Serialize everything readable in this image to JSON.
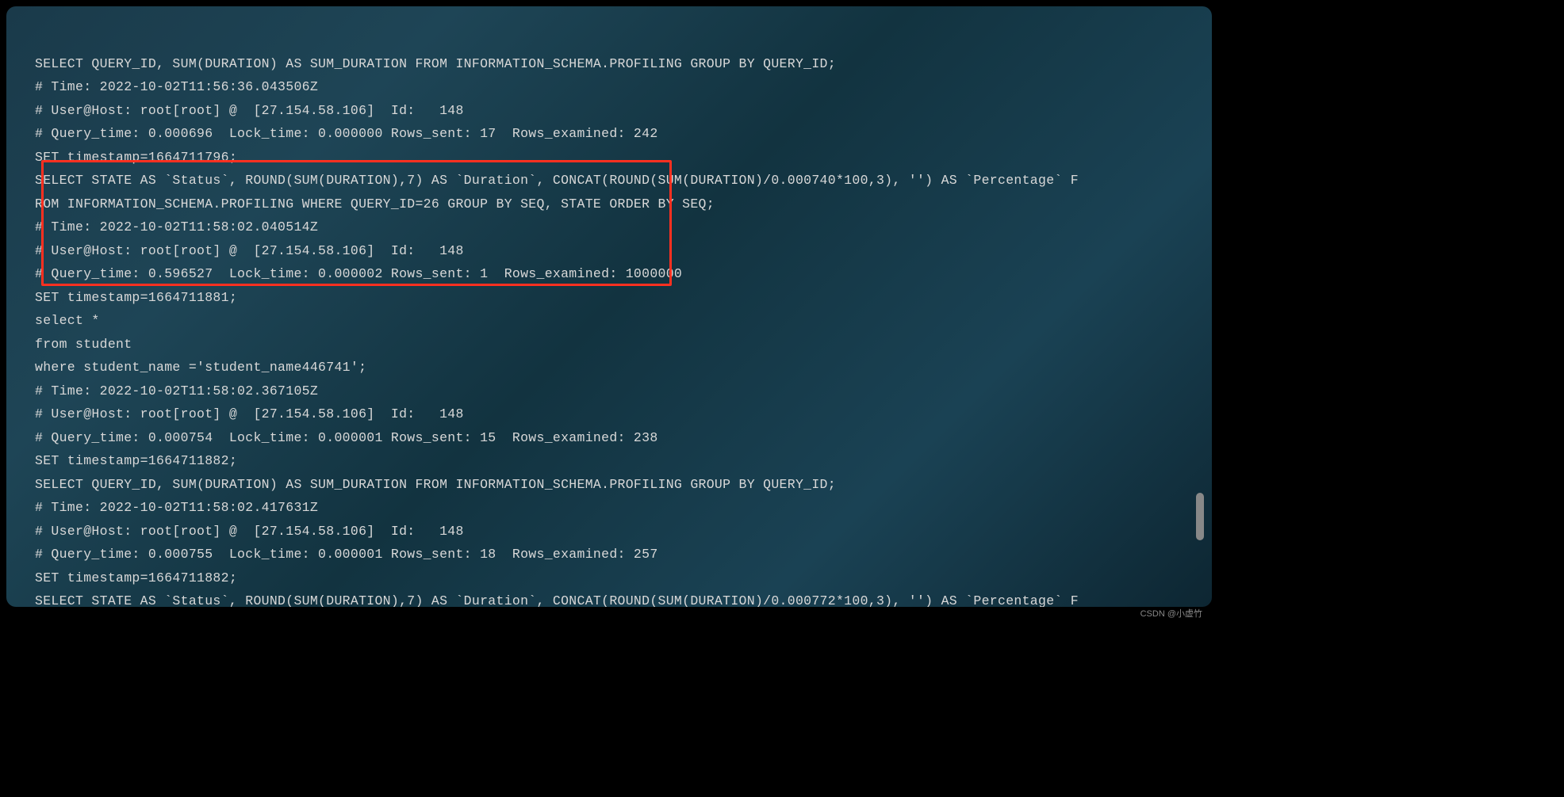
{
  "lines": {
    "l0": "SELECT QUERY_ID, SUM(DURATION) AS SUM_DURATION FROM INFORMATION_SCHEMA.PROFILING GROUP BY QUERY_ID;",
    "l1": "# Time: 2022-10-02T11:56:36.043506Z",
    "l2": "# User@Host: root[root] @  [27.154.58.106]  Id:   148",
    "l3": "# Query_time: 0.000696  Lock_time: 0.000000 Rows_sent: 17  Rows_examined: 242",
    "l4": "SET timestamp=1664711796;",
    "l5": "SELECT STATE AS `Status`, ROUND(SUM(DURATION),7) AS `Duration`, CONCAT(ROUND(SUM(DURATION)/0.000740*100,3), '') AS `Percentage` F",
    "l6": "ROM INFORMATION_SCHEMA.PROFILING WHERE QUERY_ID=26 GROUP BY SEQ, STATE ORDER BY SEQ;",
    "l7": "# Time: 2022-10-02T11:58:02.040514Z",
    "l8": "# User@Host: root[root] @  [27.154.58.106]  Id:   148",
    "l9": "# Query_time: 0.596527  Lock_time: 0.000002 Rows_sent: 1  Rows_examined: 1000000",
    "l10": "SET timestamp=1664711881;",
    "l11": "select *",
    "l12": "from student",
    "l13": "where student_name ='student_name446741';",
    "l14": "# Time: 2022-10-02T11:58:02.367105Z",
    "l15": "# User@Host: root[root] @  [27.154.58.106]  Id:   148",
    "l16": "# Query_time: 0.000754  Lock_time: 0.000001 Rows_sent: 15  Rows_examined: 238",
    "l17": "SET timestamp=1664711882;",
    "l18": "SELECT QUERY_ID, SUM(DURATION) AS SUM_DURATION FROM INFORMATION_SCHEMA.PROFILING GROUP BY QUERY_ID;",
    "l19": "# Time: 2022-10-02T11:58:02.417631Z",
    "l20": "# User@Host: root[root] @  [27.154.58.106]  Id:   148",
    "l21": "# Query_time: 0.000755  Lock_time: 0.000001 Rows_sent: 18  Rows_examined: 257",
    "l22": "SET timestamp=1664711882;",
    "l23": "SELECT STATE AS `Status`, ROUND(SUM(DURATION),7) AS `Duration`, CONCAT(ROUND(SUM(DURATION)/0.000772*100,3), '') AS `Percentage` F"
  },
  "watermark": "CSDN @小虚竹"
}
